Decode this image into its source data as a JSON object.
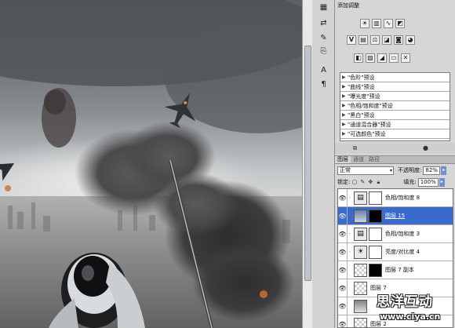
{
  "adjustments_panel": {
    "title": "添加调整",
    "row1_icons": [
      "brightness-icon",
      "levels-icon",
      "curves-icon",
      "exposure-icon"
    ],
    "row2_icons": [
      "vibrance-icon",
      "hue-saturation-icon",
      "color-balance-icon",
      "black-white-icon",
      "photo-filter-icon",
      "channel-mixer-icon"
    ],
    "row3_icons": [
      "invert-icon",
      "posterize-icon",
      "threshold-icon",
      "gradient-map-icon",
      "selective-color-icon"
    ],
    "presets": [
      "\"色阶\"预设",
      "\"曲线\"预设",
      "\"曝光度\"预设",
      "\"色相/饱和度\"预设",
      "\"黑白\"预设",
      "\"通道混合器\"预设",
      "\"可选颜色\"预设"
    ]
  },
  "layers_panel": {
    "tabs": [
      "图层",
      "通道",
      "路径"
    ],
    "blend_mode": "正常",
    "opacity_label": "不透明度:",
    "opacity_value": "82%",
    "lock_label": "锁定:",
    "fill_label": "填充:",
    "fill_value": "100%",
    "layers": [
      {
        "name": "色相/饱和度 8",
        "type": "adjustment",
        "mask": "white",
        "selected": false
      },
      {
        "name": "图层 15",
        "type": "image",
        "mask": "black",
        "selected": true
      },
      {
        "name": "色相/饱和度 3",
        "type": "adjustment",
        "mask": "white",
        "selected": false
      },
      {
        "name": "亮度/对比度 4",
        "type": "adjustment",
        "mask": "white",
        "selected": false
      },
      {
        "name": "图层 7 副本",
        "type": "image",
        "mask": "black",
        "selected": false
      },
      {
        "name": "图层 7",
        "type": "image",
        "mask": "none",
        "selected": false
      },
      {
        "name": "",
        "type": "grey",
        "mask": "none",
        "selected": false
      },
      {
        "name": "图层 2",
        "type": "image",
        "mask": "none",
        "selected": false
      }
    ]
  },
  "watermark": {
    "chinese": "思洋互动",
    "url": "www.ciya.cn"
  },
  "colors": {
    "selection": "#3a6bcc",
    "panel_bg": "#d6d6d6"
  }
}
